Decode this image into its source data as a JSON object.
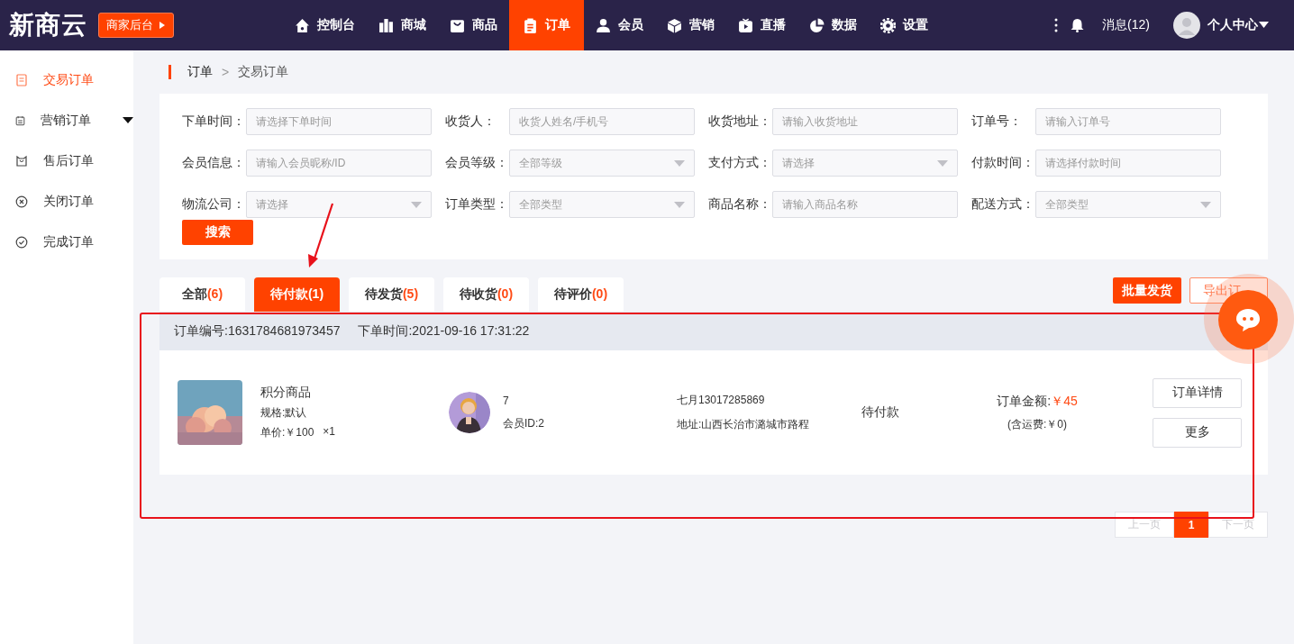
{
  "brand": {
    "logo": "新商云",
    "admin_button": "商家后台"
  },
  "nav": [
    {
      "label": "控制台",
      "selected": false
    },
    {
      "label": "商城",
      "selected": false
    },
    {
      "label": "商品",
      "selected": false
    },
    {
      "label": "订单",
      "selected": true
    },
    {
      "label": "会员",
      "selected": false
    },
    {
      "label": "营销",
      "selected": false
    },
    {
      "label": "直播",
      "selected": false
    },
    {
      "label": "数据",
      "selected": false
    },
    {
      "label": "设置",
      "selected": false
    }
  ],
  "top_right": {
    "messages": "消息(12)",
    "user": "个人中心"
  },
  "sidebar": {
    "items": [
      {
        "label": "交易订单",
        "selected": true,
        "has_submenu": false
      },
      {
        "label": "营销订单",
        "selected": false,
        "has_submenu": true
      },
      {
        "label": "售后订单",
        "selected": false,
        "has_submenu": false
      },
      {
        "label": "关闭订单",
        "selected": false,
        "has_submenu": false
      },
      {
        "label": "完成订单",
        "selected": false,
        "has_submenu": false
      }
    ]
  },
  "breadcrumb": {
    "items": [
      "订单",
      "交易订单"
    ],
    "separator": ">"
  },
  "filters": [
    {
      "label": "下单时间：",
      "placeholder": "请选择下单时间",
      "kind": "input"
    },
    {
      "label": "收货人：",
      "placeholder": "收货人姓名/手机号",
      "kind": "input"
    },
    {
      "label": "收货地址：",
      "placeholder": "请输入收货地址",
      "kind": "input"
    },
    {
      "label": "订单号：",
      "placeholder": "请输入订单号",
      "kind": "input"
    },
    {
      "label": "会员信息：",
      "placeholder": "请输入会员昵称/ID",
      "kind": "input"
    },
    {
      "label": "会员等级：",
      "placeholder": "全部等级",
      "kind": "select"
    },
    {
      "label": "支付方式：",
      "placeholder": "请选择",
      "kind": "select"
    },
    {
      "label": "付款时间：",
      "placeholder": "请选择付款时间",
      "kind": "input"
    },
    {
      "label": "物流公司：",
      "placeholder": "请选择",
      "kind": "select"
    },
    {
      "label": "订单类型：",
      "placeholder": "全部类型",
      "kind": "select"
    },
    {
      "label": "商品名称：",
      "placeholder": "请输入商品名称",
      "kind": "input"
    },
    {
      "label": "配送方式：",
      "placeholder": "全部类型",
      "kind": "select"
    }
  ],
  "search_button": "搜索",
  "tabs": [
    {
      "label": "全部",
      "count": "(6)",
      "selected": false
    },
    {
      "label": "待付款",
      "count": "(1)",
      "selected": true
    },
    {
      "label": "待发货",
      "count": "(5)",
      "selected": false
    },
    {
      "label": "待收货",
      "count": "(0)",
      "selected": false
    },
    {
      "label": "待评价",
      "count": "(0)",
      "selected": false
    }
  ],
  "actions": [
    "批量发货",
    "导出订"
  ],
  "order": {
    "number": "订单编号:1631784681973457",
    "time": "下单时间:2021-09-16 17:31:22",
    "product": {
      "kind": "picture",
      "name": "积分商品",
      "spec": "规格:默认",
      "price": "单价:￥100",
      "quantity": "×1"
    },
    "member": {
      "kind": "picture",
      "name": "7",
      "id": "会员ID:2"
    },
    "receiver": {
      "phone": "七月13017285869",
      "address": "地址:山西长治市潞城市路程"
    },
    "status": "待付款",
    "amount_label": "订单金额:",
    "amount": "￥45",
    "shipping": "(含运费:￥0)",
    "buttons": [
      "订单详情",
      "更多"
    ]
  },
  "pagination": {
    "prev": "上一页",
    "prev_disabled": true,
    "pages": [
      {
        "label": "1",
        "selected": true
      }
    ],
    "next": "下一页",
    "next_disabled": true
  }
}
